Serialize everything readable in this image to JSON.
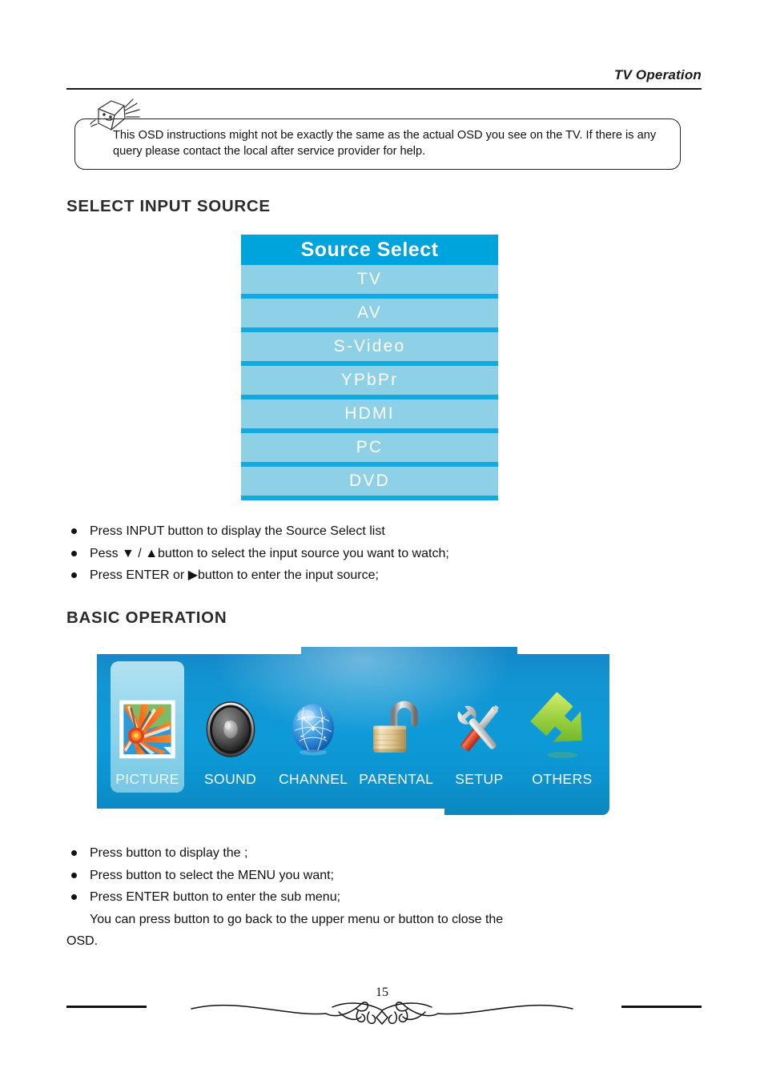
{
  "header": {
    "title": "TV Operation"
  },
  "note": {
    "icon": "hand-note-icon",
    "text": "This OSD instructions might not be exactly the same as the actual OSD you see on the TV. If there is any query please contact the local after service provider for help."
  },
  "sections": {
    "select_input_source": {
      "heading": "SELECT INPUT SOURCE",
      "osd": {
        "title": "Source Select",
        "title_bg": "#00a4dd",
        "row_bg": "#8ed1e6",
        "separator": "#12a8e0",
        "text_color": "#ffffff",
        "rows": [
          {
            "label": "TV"
          },
          {
            "label": "AV"
          },
          {
            "label": "S-Video"
          },
          {
            "label": "YPbPr"
          },
          {
            "label": "HDMI"
          },
          {
            "label": "PC"
          },
          {
            "label": "DVD"
          }
        ]
      },
      "bullets": [
        "Press INPUT button to display the Source Select list",
        "Pess ▼ / ▲button to select the input source you want to watch;",
        "Press ENTER or ▶button to enter the input source;"
      ]
    },
    "basic_operation": {
      "heading": "BASIC OPERATION",
      "osd": {
        "background_color": "#0e9ad9",
        "highlight_color": "#a9dded",
        "label_color": "#ffffff",
        "items": [
          {
            "label": "PICTURE",
            "icon": "picture-photo-icon",
            "selected": true
          },
          {
            "label": "SOUND",
            "icon": "speaker-icon",
            "selected": false
          },
          {
            "label": "CHANNEL",
            "icon": "globe-sphere-icon",
            "selected": false
          },
          {
            "label": "PARENTAL",
            "icon": "open-padlock-icon",
            "selected": false
          },
          {
            "label": "SETUP",
            "icon": "wrench-screwdriver-icon",
            "selected": false
          },
          {
            "label": "OTHERS",
            "icon": "green-arrow-icon",
            "selected": false
          }
        ]
      },
      "bullets": [
        "Press button to display the ;",
        "Press button to select the MENU you want;",
        "Press ENTER button to enter the sub menu;"
      ],
      "trailing_lines": [
        "You can press button to go back to the upper menu or button to close the",
        "OSD."
      ]
    }
  },
  "footer": {
    "page_number": "15",
    "ornament": "flourish-divider"
  }
}
